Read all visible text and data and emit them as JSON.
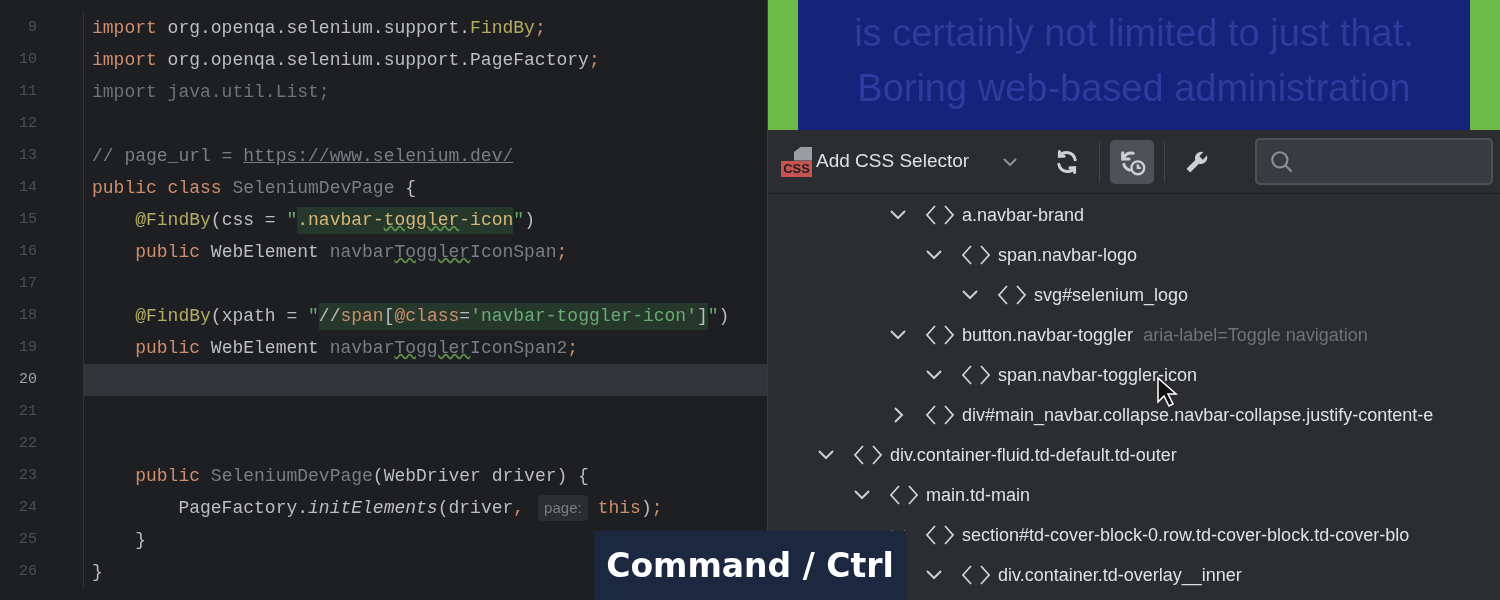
{
  "editor": {
    "lines": [
      {
        "number": "9",
        "current": false,
        "segments": [
          {
            "kind": "code",
            "tokens": [
              {
                "kind": "kw",
                "text": "import"
              },
              {
                "kind": "plain",
                "text": " org.openqa.selenium.support."
              },
              {
                "kind": "ann",
                "text": "FindBy"
              },
              {
                "kind": "kw",
                "text": ";"
              }
            ]
          }
        ]
      },
      {
        "number": "10",
        "current": false,
        "segments": [
          {
            "kind": "code",
            "tokens": [
              {
                "kind": "kw",
                "text": "import"
              },
              {
                "kind": "plain",
                "text": " org.openqa.selenium.support.PageFactory"
              },
              {
                "kind": "kw",
                "text": ";"
              }
            ]
          }
        ]
      },
      {
        "number": "11",
        "current": false,
        "segments": [
          {
            "kind": "code",
            "tokens": [
              {
                "kind": "unusedimport",
                "text": "import java.util.List;"
              }
            ]
          }
        ]
      },
      {
        "number": "12",
        "current": false
      },
      {
        "number": "13",
        "current": false,
        "segments": [
          {
            "kind": "code",
            "tokens": [
              {
                "kind": "cmt",
                "text": "// page_url = "
              },
              {
                "kind": "link",
                "text": "https://www.selenium.dev/"
              }
            ]
          }
        ]
      },
      {
        "number": "14",
        "current": false,
        "segments": [
          {
            "kind": "code",
            "tokens": [
              {
                "kind": "kw",
                "text": "public class "
              },
              {
                "kind": "unused",
                "text": "SeleniumDevPage"
              },
              {
                "kind": "plain",
                "text": " {"
              }
            ]
          }
        ]
      },
      {
        "number": "15",
        "current": false,
        "segments": [
          {
            "kind": "code",
            "tokens": [
              {
                "kind": "ann",
                "text": "    @FindBy"
              },
              {
                "kind": "plain",
                "text": "(css = "
              },
              {
                "kind": "str",
                "text": "\""
              }
            ]
          },
          {
            "kind": "injection",
            "tokens": [
              {
                "kind": "css",
                "text": ".navbar-"
              },
              {
                "kind": "css_typo",
                "text": "toggler"
              },
              {
                "kind": "css",
                "text": "-icon"
              }
            ]
          },
          {
            "kind": "code",
            "tokens": [
              {
                "kind": "str",
                "text": "\""
              },
              {
                "kind": "plain",
                "text": ")"
              }
            ]
          }
        ]
      },
      {
        "number": "16",
        "current": false,
        "segments": [
          {
            "kind": "code",
            "tokens": [
              {
                "kind": "kw",
                "text": "    public "
              },
              {
                "kind": "plain",
                "text": "WebElement "
              },
              {
                "kind": "unused",
                "text": "navbar"
              },
              {
                "kind": "unused_typo",
                "text": "Toggler"
              },
              {
                "kind": "unused",
                "text": "IconSpan"
              },
              {
                "kind": "kw",
                "text": ";"
              }
            ]
          }
        ]
      },
      {
        "number": "17",
        "current": false
      },
      {
        "number": "18",
        "current": false,
        "segments": [
          {
            "kind": "code",
            "tokens": [
              {
                "kind": "ann",
                "text": "    @FindBy"
              },
              {
                "kind": "plain",
                "text": "(xpath = "
              },
              {
                "kind": "str",
                "text": "\""
              }
            ]
          },
          {
            "kind": "injection",
            "tokens": [
              {
                "kind": "plain",
                "text": "//"
              },
              {
                "kind": "kw",
                "text": "span"
              },
              {
                "kind": "plain",
                "text": "["
              },
              {
                "kind": "kw",
                "text": "@class"
              },
              {
                "kind": "plain",
                "text": "="
              },
              {
                "kind": "str",
                "text": "'navbar-toggler-icon'"
              },
              {
                "kind": "plain",
                "text": "]"
              }
            ]
          },
          {
            "kind": "code",
            "tokens": [
              {
                "kind": "str",
                "text": "\""
              },
              {
                "kind": "plain",
                "text": ")"
              }
            ]
          }
        ]
      },
      {
        "number": "19",
        "current": false,
        "segments": [
          {
            "kind": "code",
            "tokens": [
              {
                "kind": "kw",
                "text": "    public "
              },
              {
                "kind": "plain",
                "text": "WebElement "
              },
              {
                "kind": "unused",
                "text": "navbar"
              },
              {
                "kind": "unused_typo",
                "text": "Toggler"
              },
              {
                "kind": "unused",
                "text": "IconSpan2"
              },
              {
                "kind": "kw",
                "text": ";"
              }
            ]
          }
        ]
      },
      {
        "number": "20",
        "current": true
      },
      {
        "number": "21",
        "current": false
      },
      {
        "number": "22",
        "current": false
      },
      {
        "number": "23",
        "current": false,
        "segments": [
          {
            "kind": "code",
            "tokens": [
              {
                "kind": "kw",
                "text": "    public "
              },
              {
                "kind": "unused",
                "text": "SeleniumDevPage"
              },
              {
                "kind": "plain",
                "text": "(WebDriver driver) {"
              }
            ]
          }
        ]
      },
      {
        "number": "24",
        "current": false,
        "segments": [
          {
            "kind": "code",
            "tokens": [
              {
                "kind": "plain",
                "text": "        PageFactory."
              },
              {
                "kind": "italic",
                "text": "initElements"
              },
              {
                "kind": "plain",
                "text": "(driver"
              },
              {
                "kind": "kw",
                "text": ","
              }
            ]
          },
          {
            "kind": "hint",
            "text": "page:"
          },
          {
            "kind": "code",
            "tokens": [
              {
                "kind": "kw",
                "text": "this"
              },
              {
                "kind": "plain",
                "text": ")"
              },
              {
                "kind": "kw",
                "text": ";"
              }
            ]
          }
        ]
      },
      {
        "number": "25",
        "current": false,
        "segments": [
          {
            "kind": "code",
            "tokens": [
              {
                "kind": "plain",
                "text": "    }"
              }
            ]
          }
        ]
      },
      {
        "number": "26",
        "current": false,
        "segments": [
          {
            "kind": "code",
            "tokens": [
              {
                "kind": "plain",
                "text": "}"
              }
            ]
          }
        ]
      }
    ]
  },
  "preview": {
    "lines": [
      "is certainly not limited to just that.",
      "Boring web-based administration"
    ]
  },
  "toolbar": {
    "add_selector": {
      "icon_text": "CSS",
      "label": "Add CSS Selector"
    },
    "buttons": [
      {
        "kind": "refresh",
        "selected": false
      },
      {
        "kind": "history",
        "selected": true
      },
      {
        "kind": "settings",
        "selected": false
      }
    ]
  },
  "tree": {
    "items": [
      {
        "children": [
          {
            "children": [
              {
                "children": [
                  {
                    "label": "a.navbar-brand",
                    "expanded": true,
                    "children": [
                      {
                        "label": "span.navbar-logo",
                        "expanded": true,
                        "children": [
                          {
                            "label": "svg#selenium_logo",
                            "expanded": true
                          }
                        ]
                      }
                    ]
                  },
                  {
                    "label": "button.navbar-toggler",
                    "attribute": "aria-label=Toggle navigation",
                    "expanded": true,
                    "children": [
                      {
                        "label": "span.navbar-toggler-icon",
                        "expanded": true
                      }
                    ]
                  },
                  {
                    "label": "div#main_navbar.collapse.navbar-collapse.justify-content-e",
                    "expanded": false
                  }
                ]
              }
            ]
          },
          {
            "label": "div.container-fluid.td-default.td-outer",
            "expanded": true,
            "children": [
              {
                "label": "main.td-main",
                "expanded": true,
                "children": [
                  {
                    "label": "section#td-cover-block-0.row.td-cover-block.td-cover-blo",
                    "expanded": true,
                    "children": [
                      {
                        "label": "div.container.td-overlay__inner",
                        "expanded": true
                      }
                    ]
                  }
                ]
              }
            ]
          }
        ]
      }
    ]
  },
  "key_hint": "Command / Ctrl"
}
